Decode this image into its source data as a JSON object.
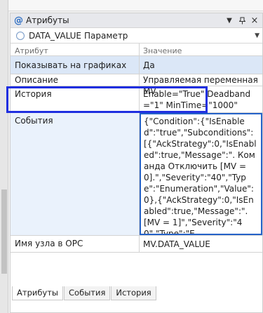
{
  "panel": {
    "title": "Атрибуты",
    "object_name": "DATA_VALUE",
    "object_type": "Параметр"
  },
  "grid": {
    "col_attribute": "Атрибут",
    "col_value": "Значение",
    "rows": [
      {
        "key": "Показывать на графиках",
        "value": "Да"
      },
      {
        "key": "Описание",
        "value": "Управляемая переменная MV"
      },
      {
        "key": "История",
        "value": "Enable=\"True\" Deadband=\"1\" MinTime=\"1000\""
      },
      {
        "key": "События",
        "value": "{\"Condition\":{\"IsEnabled\":\"true\",\"Subconditions\":[{\"AckStrategy\":0,\"IsEnabled\":true,\"Message\":\". Команда Отключить [MV = 0].\",\"Severity\":\"40\",\"Type\":\"Enumeration\",\"Value\":0},{\"AckStrategy\":0,\"IsEnabled\":true,\"Message\":\". [MV = 1]\",\"Severity\":\"40\",\"Type\":\"E"
      },
      {
        "key": "Имя узла в OPC",
        "value": "MV.DATA_VALUE"
      }
    ]
  },
  "tabs": [
    "Атрибуты",
    "События",
    "История"
  ],
  "colors": {
    "accent": "#2563c9",
    "highlight": "#1f2fe0",
    "selection": "#dbe7f7"
  }
}
